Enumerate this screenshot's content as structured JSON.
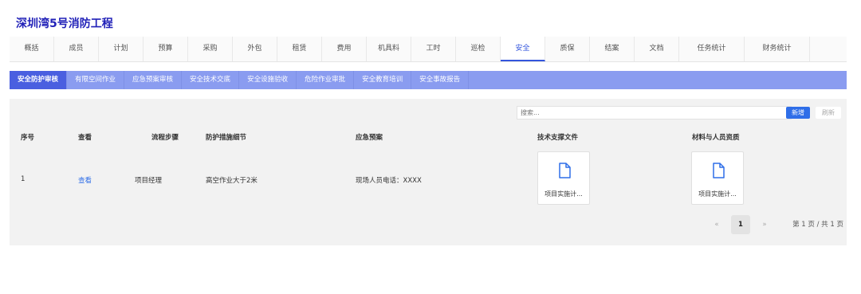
{
  "project_title": "深圳湾5号消防工程",
  "main_tabs": [
    "概括",
    "成员",
    "计划",
    "预算",
    "采购",
    "外包",
    "租赁",
    "费用",
    "机具料",
    "工时",
    "巡检",
    "安全",
    "质保",
    "结案",
    "文档",
    "任务统计",
    "财务统计"
  ],
  "main_tab_active": "安全",
  "sub_tabs": [
    "安全防护审核",
    "有限空间作业",
    "应急预案审核",
    "安全技术交底",
    "安全设施验收",
    "危险作业审批",
    "安全教育培训",
    "安全事故报告"
  ],
  "sub_tab_active": "安全防护审核",
  "toolbar": {
    "search_placeholder": "搜索...",
    "new_label": "新增",
    "refresh_label": "刷新"
  },
  "table": {
    "headers": [
      "序号",
      "查看",
      "流程步骤",
      "防护措施细节",
      "应急预案",
      "技术支撑文件",
      "材料与人员资质"
    ],
    "rows": [
      {
        "index": "1",
        "view": "查看",
        "step": "项目经理",
        "detail": "高空作业大于2米",
        "plan": "现场人员电话：XXXX",
        "tech_file": "项目实施计...",
        "material_file": "项目实施计..."
      }
    ]
  },
  "pagination": {
    "prev": "«",
    "current": "1",
    "next": "»",
    "info": "第 1 页 / 共 1 页"
  },
  "colors": {
    "title": "#2222b8",
    "accent": "#2f6ee8",
    "subnav_bg": "#8a9cf0",
    "subnav_active": "#4a5fe0"
  }
}
